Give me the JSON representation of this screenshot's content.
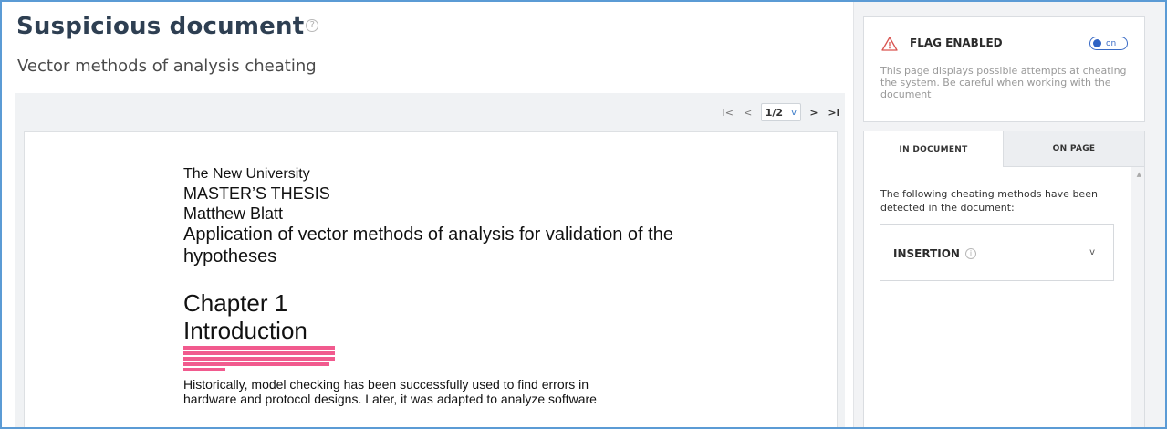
{
  "header": {
    "title": "Suspicious document",
    "help_icon": "?",
    "subtitle": "Vector methods of analysis cheating"
  },
  "pager": {
    "first_icon": "I<",
    "prev_icon": "<",
    "current_page": "1/2",
    "dropdown_icon": "v",
    "next_icon": ">",
    "last_icon": ">I"
  },
  "document": {
    "lines": {
      "university": "The New University",
      "degree": "MASTER’S THESIS",
      "author": "Matthew Blatt",
      "topic_1": "Application of vector methods of analysis for validation of the",
      "topic_2": "hypotheses",
      "chapter": "Chapter 1",
      "section": "Introduction",
      "body_1": "Historically, model checking has been successfully used to find errors in",
      "body_2": "hardware and protocol designs. Later, it was adapted to analyze software"
    },
    "highlight_color": "#ee3d7a"
  },
  "flag": {
    "title": "FLAG ENABLED",
    "toggle_label": "on",
    "toggle_state": "on",
    "description": "This page displays possible attempts at cheating the system. Be careful when working with the document",
    "accent": "#2f63c4",
    "warning_color": "#d9534f"
  },
  "tabs": [
    {
      "label": "IN DOCUMENT",
      "active": true
    },
    {
      "label": "ON PAGE",
      "active": false
    }
  ],
  "panel": {
    "intro": "The following cheating methods have been detected in the document:",
    "methods": [
      {
        "name": "INSERTION",
        "info_icon": "i",
        "expand_icon": "v"
      }
    ]
  }
}
